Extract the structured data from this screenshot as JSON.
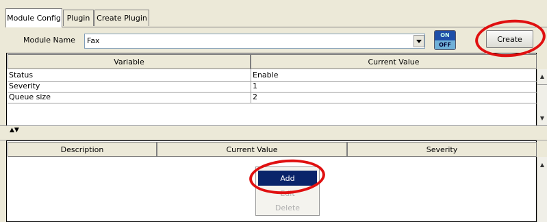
{
  "tabs": [
    {
      "label": "Module Config",
      "active": true
    },
    {
      "label": "Plugin",
      "active": false
    },
    {
      "label": "Create Plugin",
      "active": false
    }
  ],
  "module": {
    "label": "Module Name",
    "value": "Fax",
    "toggle_on": "ON",
    "toggle_off": "OFF",
    "create_label": "Create"
  },
  "variables_table": {
    "headers": [
      "Variable",
      "Current Value"
    ],
    "rows": [
      {
        "variable": "Status",
        "value": "Enable"
      },
      {
        "variable": "Severity",
        "value": "1"
      },
      {
        "variable": "Queue size",
        "value": "2"
      }
    ]
  },
  "events_table": {
    "headers": [
      "Description",
      "Current Value",
      "Severity"
    ]
  },
  "context_menu": {
    "items": [
      {
        "label": "Add",
        "state": "highlighted"
      },
      {
        "label": "Edit",
        "state": "disabled"
      },
      {
        "label": "Delete",
        "state": "disabled"
      }
    ]
  },
  "annotation_color": "#e01010"
}
